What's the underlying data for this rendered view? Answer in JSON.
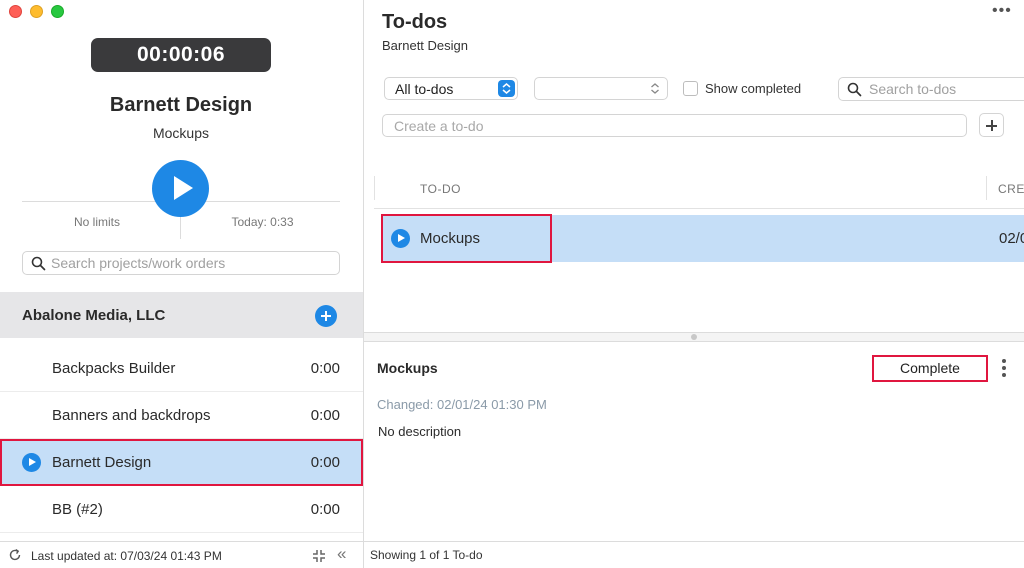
{
  "window": {
    "controls": [
      "close",
      "minimize",
      "zoom"
    ]
  },
  "sidebar": {
    "timer": "00:00:06",
    "client_name": "Barnett Design",
    "work_order": "Mockups",
    "limits_text": "No limits",
    "today_text": "Today: 0:33",
    "search_placeholder": "Search projects/work orders",
    "group_title": "Abalone Media, LLC",
    "projects": [
      {
        "name": "Backpacks Builder",
        "time": "0:00",
        "selected": false
      },
      {
        "name": "Banners and backdrops",
        "time": "0:00",
        "selected": false
      },
      {
        "name": "Barnett Design",
        "time": "0:00",
        "selected": true
      },
      {
        "name": "BB (#2)",
        "time": "0:00",
        "selected": false
      }
    ],
    "footer": {
      "last_updated": "Last updated at: 07/03/24 01:43 PM",
      "collapse_glyph": "«"
    }
  },
  "main": {
    "title": "To-dos",
    "subtitle": "Barnett Design",
    "more_glyph": "•••",
    "filter_value": "All to-dos",
    "second_filter_value": "",
    "show_completed_label": "Show completed",
    "show_completed_checked": false,
    "search_placeholder": "Search to-dos",
    "create_placeholder": "Create a to-do",
    "table": {
      "columns": [
        "TO-DO",
        "CREA"
      ],
      "rows": [
        {
          "name": "Mockups",
          "created": "02/0"
        }
      ]
    },
    "detail": {
      "title": "Mockups",
      "complete_label": "Complete",
      "changed": "Changed: 02/01/24 01:30 PM",
      "description": "No description"
    },
    "footer": {
      "showing": "Showing 1 of 1 To-do"
    }
  },
  "colors": {
    "accent": "#1e88e5",
    "selection": "#c5def7",
    "highlight_box": "#e0163f",
    "timer_bg": "#3a3a3c"
  }
}
